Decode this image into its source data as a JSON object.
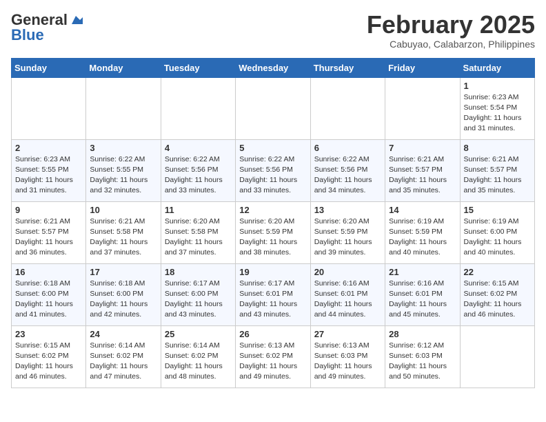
{
  "logo": {
    "general": "General",
    "blue": "Blue"
  },
  "title": {
    "month_year": "February 2025",
    "location": "Cabuyao, Calabarzon, Philippines"
  },
  "days_of_week": [
    "Sunday",
    "Monday",
    "Tuesday",
    "Wednesday",
    "Thursday",
    "Friday",
    "Saturday"
  ],
  "weeks": [
    [
      {
        "day": "",
        "info": ""
      },
      {
        "day": "",
        "info": ""
      },
      {
        "day": "",
        "info": ""
      },
      {
        "day": "",
        "info": ""
      },
      {
        "day": "",
        "info": ""
      },
      {
        "day": "",
        "info": ""
      },
      {
        "day": "1",
        "info": "Sunrise: 6:23 AM\nSunset: 5:54 PM\nDaylight: 11 hours and 31 minutes."
      }
    ],
    [
      {
        "day": "2",
        "info": "Sunrise: 6:23 AM\nSunset: 5:55 PM\nDaylight: 11 hours and 31 minutes."
      },
      {
        "day": "3",
        "info": "Sunrise: 6:22 AM\nSunset: 5:55 PM\nDaylight: 11 hours and 32 minutes."
      },
      {
        "day": "4",
        "info": "Sunrise: 6:22 AM\nSunset: 5:56 PM\nDaylight: 11 hours and 33 minutes."
      },
      {
        "day": "5",
        "info": "Sunrise: 6:22 AM\nSunset: 5:56 PM\nDaylight: 11 hours and 33 minutes."
      },
      {
        "day": "6",
        "info": "Sunrise: 6:22 AM\nSunset: 5:56 PM\nDaylight: 11 hours and 34 minutes."
      },
      {
        "day": "7",
        "info": "Sunrise: 6:21 AM\nSunset: 5:57 PM\nDaylight: 11 hours and 35 minutes."
      },
      {
        "day": "8",
        "info": "Sunrise: 6:21 AM\nSunset: 5:57 PM\nDaylight: 11 hours and 35 minutes."
      }
    ],
    [
      {
        "day": "9",
        "info": "Sunrise: 6:21 AM\nSunset: 5:57 PM\nDaylight: 11 hours and 36 minutes."
      },
      {
        "day": "10",
        "info": "Sunrise: 6:21 AM\nSunset: 5:58 PM\nDaylight: 11 hours and 37 minutes."
      },
      {
        "day": "11",
        "info": "Sunrise: 6:20 AM\nSunset: 5:58 PM\nDaylight: 11 hours and 37 minutes."
      },
      {
        "day": "12",
        "info": "Sunrise: 6:20 AM\nSunset: 5:59 PM\nDaylight: 11 hours and 38 minutes."
      },
      {
        "day": "13",
        "info": "Sunrise: 6:20 AM\nSunset: 5:59 PM\nDaylight: 11 hours and 39 minutes."
      },
      {
        "day": "14",
        "info": "Sunrise: 6:19 AM\nSunset: 5:59 PM\nDaylight: 11 hours and 40 minutes."
      },
      {
        "day": "15",
        "info": "Sunrise: 6:19 AM\nSunset: 6:00 PM\nDaylight: 11 hours and 40 minutes."
      }
    ],
    [
      {
        "day": "16",
        "info": "Sunrise: 6:18 AM\nSunset: 6:00 PM\nDaylight: 11 hours and 41 minutes."
      },
      {
        "day": "17",
        "info": "Sunrise: 6:18 AM\nSunset: 6:00 PM\nDaylight: 11 hours and 42 minutes."
      },
      {
        "day": "18",
        "info": "Sunrise: 6:17 AM\nSunset: 6:00 PM\nDaylight: 11 hours and 43 minutes."
      },
      {
        "day": "19",
        "info": "Sunrise: 6:17 AM\nSunset: 6:01 PM\nDaylight: 11 hours and 43 minutes."
      },
      {
        "day": "20",
        "info": "Sunrise: 6:16 AM\nSunset: 6:01 PM\nDaylight: 11 hours and 44 minutes."
      },
      {
        "day": "21",
        "info": "Sunrise: 6:16 AM\nSunset: 6:01 PM\nDaylight: 11 hours and 45 minutes."
      },
      {
        "day": "22",
        "info": "Sunrise: 6:15 AM\nSunset: 6:02 PM\nDaylight: 11 hours and 46 minutes."
      }
    ],
    [
      {
        "day": "23",
        "info": "Sunrise: 6:15 AM\nSunset: 6:02 PM\nDaylight: 11 hours and 46 minutes."
      },
      {
        "day": "24",
        "info": "Sunrise: 6:14 AM\nSunset: 6:02 PM\nDaylight: 11 hours and 47 minutes."
      },
      {
        "day": "25",
        "info": "Sunrise: 6:14 AM\nSunset: 6:02 PM\nDaylight: 11 hours and 48 minutes."
      },
      {
        "day": "26",
        "info": "Sunrise: 6:13 AM\nSunset: 6:02 PM\nDaylight: 11 hours and 49 minutes."
      },
      {
        "day": "27",
        "info": "Sunrise: 6:13 AM\nSunset: 6:03 PM\nDaylight: 11 hours and 49 minutes."
      },
      {
        "day": "28",
        "info": "Sunrise: 6:12 AM\nSunset: 6:03 PM\nDaylight: 11 hours and 50 minutes."
      },
      {
        "day": "",
        "info": ""
      }
    ]
  ]
}
